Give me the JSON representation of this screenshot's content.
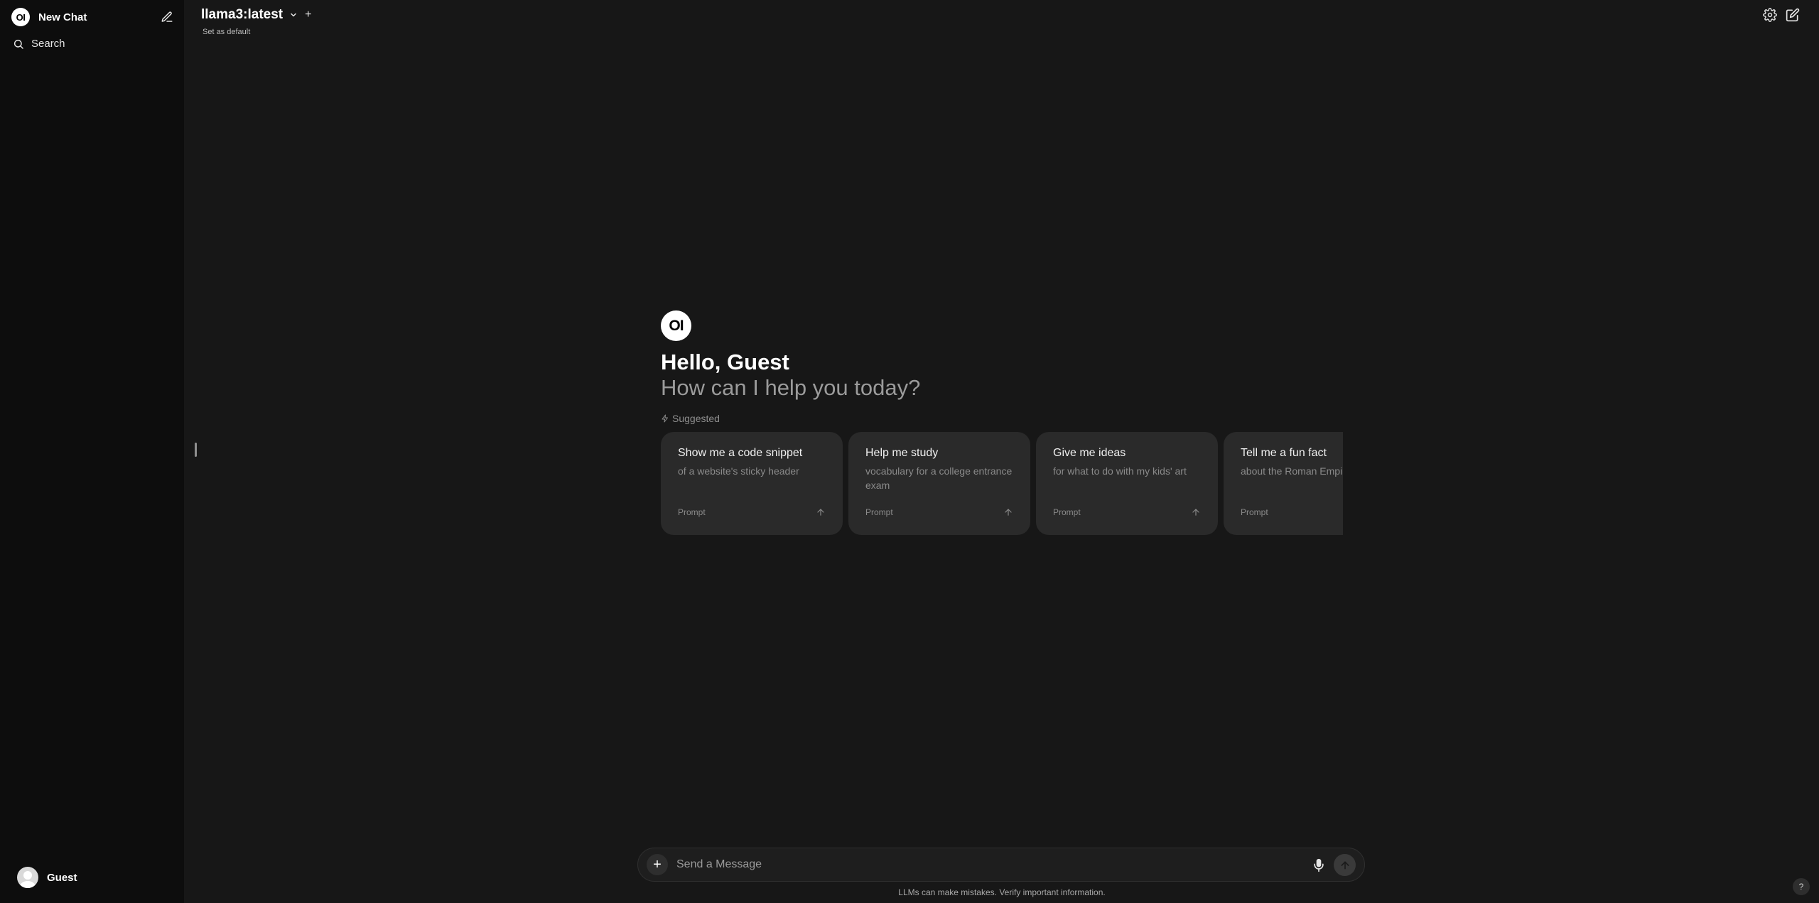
{
  "sidebar": {
    "logo_text": "OI",
    "new_chat_label": "New Chat",
    "search_label": "Search",
    "user_name": "Guest"
  },
  "header": {
    "model_name": "llama3:latest",
    "add_model_label": "+",
    "set_default_label": "Set as default"
  },
  "welcome": {
    "logo_text": "OI",
    "greeting": "Hello, Guest",
    "subtitle": "How can I help you today?",
    "suggested_label": "Suggested"
  },
  "suggestions": [
    {
      "title": "Show me a code snippet",
      "subtitle": "of a website's sticky header",
      "tag": "Prompt"
    },
    {
      "title": "Help me study",
      "subtitle": "vocabulary for a college entrance exam",
      "tag": "Prompt"
    },
    {
      "title": "Give me ideas",
      "subtitle": "for what to do with my kids' art",
      "tag": "Prompt"
    },
    {
      "title": "Tell me a fun fact",
      "subtitle": "about the Roman Empire",
      "tag": "Prompt"
    }
  ],
  "composer": {
    "placeholder": "Send a Message",
    "plus_label": "+",
    "disclaimer": "LLMs can make mistakes. Verify important information.",
    "help_label": "?"
  }
}
